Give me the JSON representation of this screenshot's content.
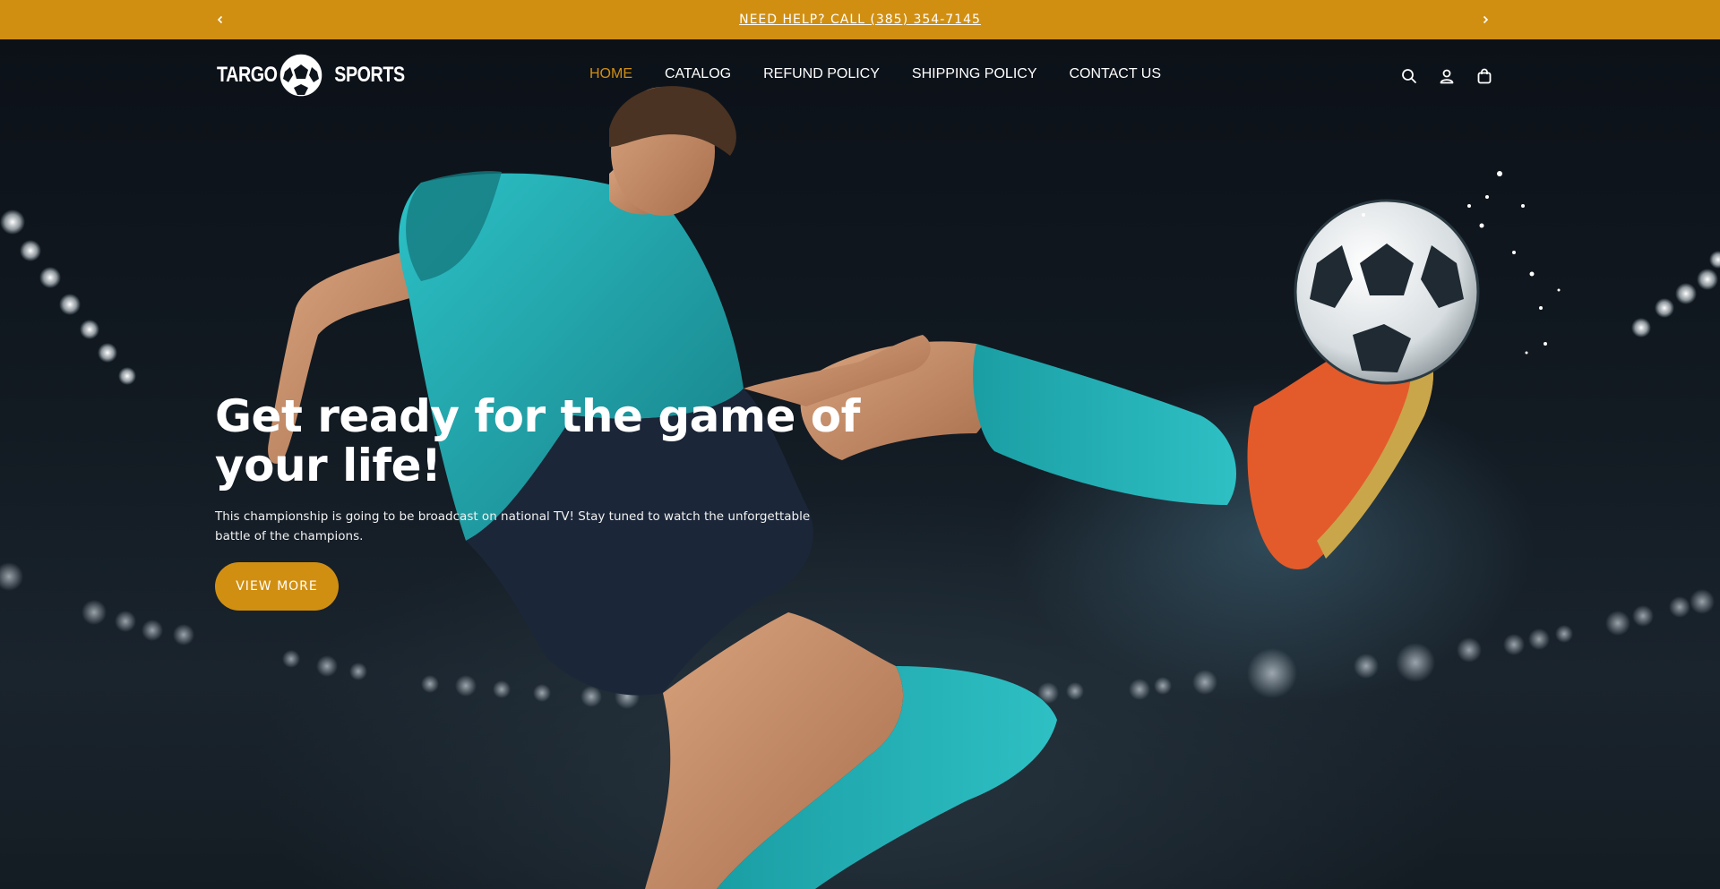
{
  "announcement": {
    "text": "NEED HELP? CALL (385) 354-7145",
    "prev_icon": "chevron-left-icon",
    "next_icon": "chevron-right-icon"
  },
  "header": {
    "logo": {
      "word_left": "TARGO",
      "word_right": "SPORTS",
      "icon": "soccer-ball-icon"
    },
    "nav": [
      {
        "label": "HOME",
        "active": true
      },
      {
        "label": "CATALOG",
        "active": false
      },
      {
        "label": "REFUND POLICY",
        "active": false
      },
      {
        "label": "SHIPPING POLICY",
        "active": false
      },
      {
        "label": "CONTACT US",
        "active": false
      }
    ],
    "icons": [
      "search-icon",
      "account-icon",
      "cart-icon"
    ]
  },
  "hero": {
    "title": "Get ready for the game of your life!",
    "description": "This championship is going to be broadcast on national TV! Stay tuned to watch the unforgettable battle of the champions.",
    "cta_label": "VIEW MORE"
  },
  "colors": {
    "accent": "#d18f12",
    "background": "#0f151c",
    "text": "#ffffff",
    "jersey": "#1fa7ad"
  }
}
